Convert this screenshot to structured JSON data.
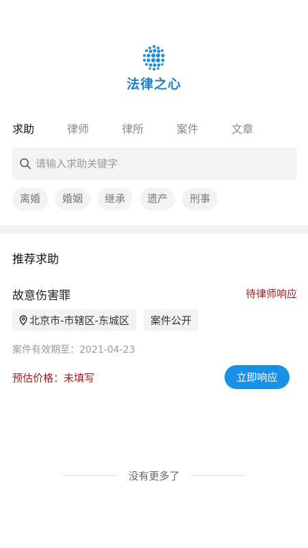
{
  "logo": {
    "text": "法律之心",
    "icon": "globe-dots-icon"
  },
  "tabs": [
    {
      "label": "求助",
      "active": true
    },
    {
      "label": "律师",
      "active": false
    },
    {
      "label": "律所",
      "active": false
    },
    {
      "label": "案件",
      "active": false
    },
    {
      "label": "文章",
      "active": false
    }
  ],
  "search": {
    "placeholder": "请输入求助关键字",
    "value": "",
    "icon": "search-icon"
  },
  "categories": [
    "离婚",
    "婚姻",
    "继承",
    "遗产",
    "刑事"
  ],
  "section": {
    "title": "推荐求助"
  },
  "case": {
    "title": "故意伤害罪",
    "status": "待律师响应",
    "location": "北京市-市辖区-东城区",
    "visibility": "案件公开",
    "validity": "案件有效期至：2021-04-23",
    "price": "预估价格：未填写",
    "respond_label": "立即响应"
  },
  "footer": {
    "end_text": "没有更多了"
  },
  "colors": {
    "accent": "#1a91e8",
    "status_red": "#a11e1e",
    "logo_blue": "#1f7fc3"
  }
}
